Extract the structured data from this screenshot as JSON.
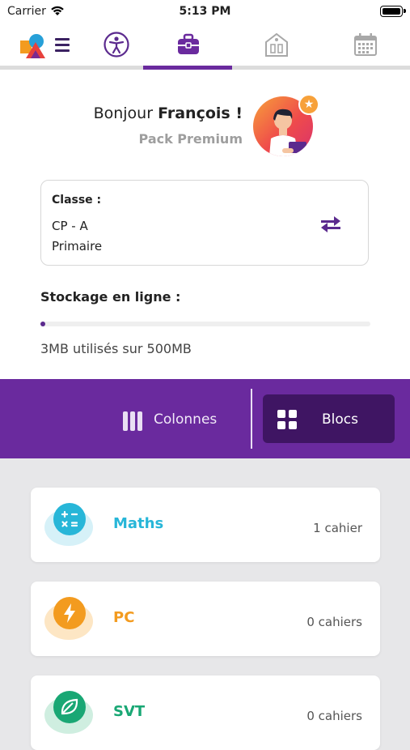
{
  "status_bar": {
    "carrier": "Carrier",
    "time": "5:13 PM"
  },
  "nav": {
    "tabs": [
      {
        "icon": "accessibility-icon",
        "active": false
      },
      {
        "icon": "briefcase-icon",
        "active": true
      },
      {
        "icon": "school-icon",
        "active": false
      },
      {
        "icon": "calendar-icon",
        "active": false
      }
    ]
  },
  "header": {
    "greeting": "Bonjour",
    "user_name": "François !",
    "plan": "Pack Premium"
  },
  "class_card": {
    "label": "Classe :",
    "class_name": "CP - A",
    "level": "Primaire"
  },
  "storage": {
    "title": "Stockage en ligne :",
    "used_mb": 3,
    "total_mb": 500,
    "usage_text": "3MB utilisés sur 500MB"
  },
  "view_toggle": {
    "columns_label": "Colonnes",
    "blocks_label": "Blocs",
    "selected": "Blocs"
  },
  "subjects": [
    {
      "name": "Maths",
      "count_text": "1 cahier",
      "color": "#27b6d8",
      "blob": "#d6f1f8",
      "icon": "calculator-icon"
    },
    {
      "name": "PC",
      "count_text": "0 cahiers",
      "color": "#f39b1f",
      "blob": "#fde6c4",
      "icon": "lightning-icon"
    },
    {
      "name": "SVT",
      "count_text": "0 cahiers",
      "color": "#19a774",
      "blob": "#cfeee0",
      "icon": "leaf-icon"
    }
  ],
  "colors": {
    "accent": "#6a2a9e",
    "accent_dark": "#3f1563"
  }
}
